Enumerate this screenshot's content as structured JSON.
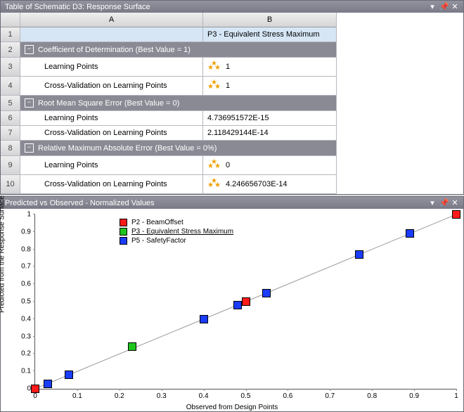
{
  "topPanel": {
    "title": "Table of Schematic D3: Response Surface",
    "colA": "A",
    "colB": "B",
    "row1_b": "P3 - Equivalent Stress Maximum",
    "groups": [
      {
        "label": "Coefficient of Determination (Best Value = 1)",
        "rows": [
          {
            "num": "3",
            "label": "Learning Points",
            "val": "1",
            "stars": true
          },
          {
            "num": "4",
            "label": "Cross-Validation on Learning Points",
            "val": "1",
            "stars": true
          }
        ]
      },
      {
        "label": "Root Mean Square Error (Best Value = 0)",
        "rows": [
          {
            "num": "6",
            "label": "Learning Points",
            "val": "4.736951572E-15",
            "stars": false
          },
          {
            "num": "7",
            "label": "Cross-Validation on Learning Points",
            "val": "2.118429144E-14",
            "stars": false
          }
        ]
      },
      {
        "label": "Relative Maximum Absolute Error (Best Value = 0%)",
        "rows": [
          {
            "num": "9",
            "label": "Learning Points",
            "val": "0",
            "stars": true
          },
          {
            "num": "10",
            "label": "Cross-Validation on Learning Points",
            "val": "4.246656703E-14",
            "stars": true
          }
        ]
      }
    ],
    "groupNums": [
      "2",
      "5",
      "8"
    ]
  },
  "chartPanel": {
    "title": "Predicted vs Observed - Normalized Values",
    "xlabel": "Observed from Design Points",
    "ylabel": "Predicted from the Response Surface",
    "legend": [
      {
        "color": "red",
        "label": "P2 - BeamOffset"
      },
      {
        "color": "green",
        "label": "P3 - Equivalent Stress Maximum",
        "underline": true
      },
      {
        "color": "blue",
        "label": "P5 - SafetyFactor"
      }
    ]
  },
  "chart_data": {
    "type": "scatter",
    "title": "Predicted vs Observed - Normalized Values",
    "xlabel": "Observed from Design Points",
    "ylabel": "Predicted from the Response Surface",
    "xlim": [
      0,
      1
    ],
    "ylim": [
      0,
      1
    ],
    "ticks": [
      0,
      0.1,
      0.2,
      0.3,
      0.4,
      0.5,
      0.6,
      0.7,
      0.8,
      0.9,
      1
    ],
    "reference_line": [
      [
        0,
        0
      ],
      [
        1,
        1
      ]
    ],
    "series": [
      {
        "name": "P2 - BeamOffset",
        "color": "#ff1a1a",
        "points": [
          [
            0.0,
            0.0
          ],
          [
            0.5,
            0.5
          ],
          [
            1.0,
            1.0
          ]
        ]
      },
      {
        "name": "P3 - Equivalent Stress Maximum",
        "color": "#1ec51e",
        "points": [
          [
            0.23,
            0.24
          ]
        ]
      },
      {
        "name": "P5 - SafetyFactor",
        "color": "#1a3cff",
        "points": [
          [
            0.03,
            0.03
          ],
          [
            0.08,
            0.08
          ],
          [
            0.4,
            0.4
          ],
          [
            0.48,
            0.48
          ],
          [
            0.55,
            0.55
          ],
          [
            0.77,
            0.77
          ],
          [
            0.89,
            0.89
          ]
        ]
      }
    ]
  }
}
